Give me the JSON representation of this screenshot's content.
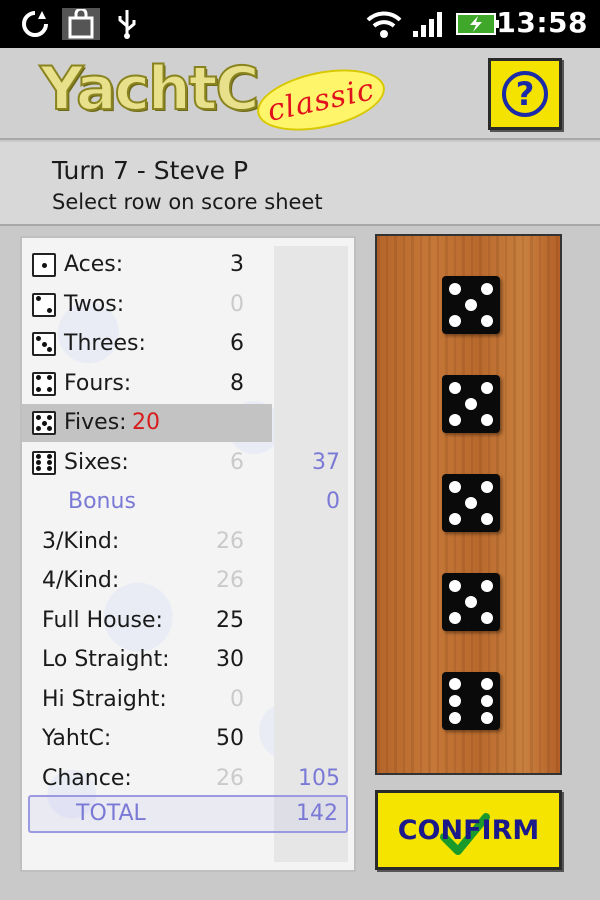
{
  "status_bar": {
    "time": "13:58",
    "icons": [
      "sync-icon",
      "bag-icon",
      "usb-icon",
      "wifi-icon",
      "signal-icon",
      "battery-charging-icon"
    ]
  },
  "header": {
    "logo_text": "YachtC",
    "logo_badge": "classic",
    "help_label": "?"
  },
  "turn_info": {
    "turn": "Turn 7 - Steve P",
    "instruction": "Select row on score sheet"
  },
  "score_sheet": {
    "rows": [
      {
        "label": "Aces:",
        "value": "3",
        "style": "dark",
        "die": 1
      },
      {
        "label": "Twos:",
        "value": "0",
        "style": "ghost",
        "die": 2
      },
      {
        "label": "Threes:",
        "value": "6",
        "style": "dark",
        "die": 3
      },
      {
        "label": "Fours:",
        "value": "8",
        "style": "dark",
        "die": 4
      },
      {
        "label": "Fives:",
        "value": "20",
        "style": "red",
        "die": 5,
        "selected": true
      },
      {
        "label": "Sixes:",
        "value": "6",
        "style": "ghost",
        "die": 6,
        "total": "37"
      },
      {
        "label": "Bonus",
        "value": "",
        "style": "bonus",
        "total": "0"
      },
      {
        "label": "3/Kind:",
        "value": "26",
        "style": "ghost"
      },
      {
        "label": "4/Kind:",
        "value": "26",
        "style": "ghost"
      },
      {
        "label": "Full House:",
        "value": "25",
        "style": "dark"
      },
      {
        "label": "Lo Straight:",
        "value": "30",
        "style": "dark"
      },
      {
        "label": "Hi Straight:",
        "value": "0",
        "style": "ghost"
      },
      {
        "label": "YahtC:",
        "value": "50",
        "style": "dark"
      },
      {
        "label": "Chance:",
        "value": "26",
        "style": "ghost",
        "total": "105"
      }
    ],
    "total_label": "TOTAL",
    "total_value": "142"
  },
  "dice": [
    5,
    5,
    5,
    5,
    6
  ],
  "confirm_label": "CONFIRM"
}
